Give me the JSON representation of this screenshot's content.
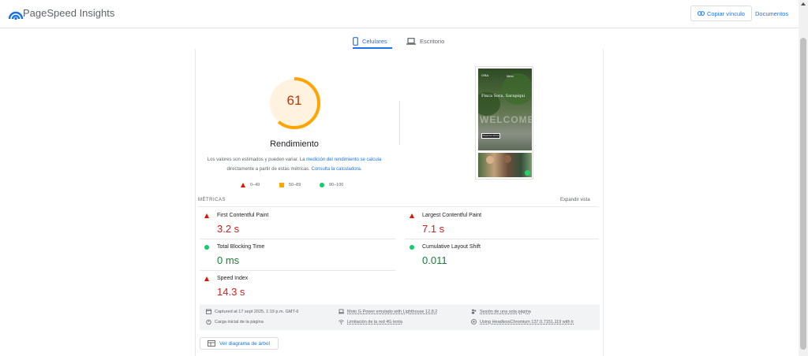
{
  "header": {
    "title": "PageSpeed Insights",
    "copy_link_label": "Copiar vínculo",
    "docs_label": "Documentos"
  },
  "tabs": [
    {
      "label": "Celulares",
      "icon": "phone-icon",
      "active": true
    },
    {
      "label": "Escritorio",
      "icon": "laptop-icon",
      "active": false
    }
  ],
  "score": {
    "value": "61",
    "percent": 61,
    "label": "Rendimiento",
    "color": "#ffa400"
  },
  "description": {
    "part1": "Los valores son estimados y pueden variar. La ",
    "link1": "medición del rendimiento se calcula",
    "part2": " directamente a partir de estas métricas. ",
    "link2": "Consulta la calculadora."
  },
  "legend": [
    {
      "range": "0–49",
      "shape": "triangle",
      "color": "#eb0f00"
    },
    {
      "range": "50–89",
      "shape": "square",
      "color": "#ffa400"
    },
    {
      "range": "90–100",
      "shape": "circle",
      "color": "#0cce6b"
    }
  ],
  "thumbnail": {
    "brand": "ORA",
    "menu_text": "Menu",
    "heading": "Finca Sora, Sarapiqui",
    "sign_text": "WELCOME",
    "button_text": "Reservar ahora"
  },
  "metrics_section": {
    "title": "MÉTRICAS",
    "expand_label": "Expandir vista"
  },
  "metrics": [
    {
      "name": "First Contentful Paint",
      "value": "3.2 s",
      "status": "fail"
    },
    {
      "name": "Largest Contentful Paint",
      "value": "7.1 s",
      "status": "fail"
    },
    {
      "name": "Total Blocking Time",
      "value": "0 ms",
      "status": "pass"
    },
    {
      "name": "Cumulative Layout Shift",
      "value": "0.011",
      "status": "pass"
    },
    {
      "name": "Speed Index",
      "value": "14.3 s",
      "status": "fail"
    }
  ],
  "info": {
    "captured": "Captured at 17 sept 2025, 1:19 p.m. GMT-6",
    "initial_load": "Carga inicial de la página",
    "device": "Moto G Power emulado with Lighthouse 12.8.2",
    "network": "Limitación de la red 4G lenta",
    "session": "Sesión de una sola página",
    "browser": "Using HeadlessChromium 137.0.7151.119 with lr"
  },
  "tree_button_label": "Ver diagrama de árbol"
}
